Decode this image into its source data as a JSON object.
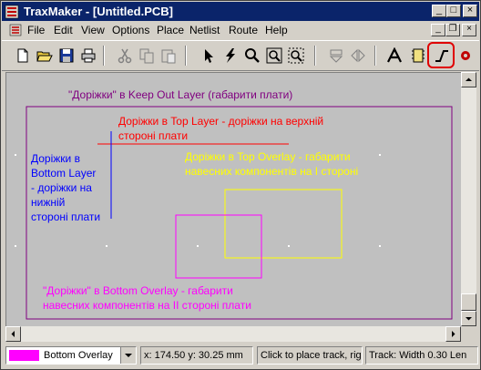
{
  "titlebar": {
    "title": "TraxMaker - [Untitled.PCB]",
    "min": "_",
    "max": "□",
    "close": "×"
  },
  "menu": {
    "items": [
      "File",
      "Edit",
      "View",
      "Options",
      "Place",
      "Netlist",
      "Route",
      "Help"
    ]
  },
  "canvas": {
    "labels": {
      "keepout": "\"Доріжки\" в Keep Out Layer (габарити плати)",
      "top_layer": "Доріжки в Top Layer - доріжки на верхній\nстороні плати",
      "bottom_layer": "Доріжки в\nBottom Layer\n- доріжки на\nнижній\nстороні плати",
      "top_overlay": "Доріжки в Top Overlay - габарити\nнавесних компонентів на І стороні",
      "bottom_overlay": "\"Доріжки\" в Bottom Overlay - габарити\nнавесних компонентів на ІІ стороні плати"
    },
    "colors": {
      "keepout": "#800080",
      "top_layer": "#ff0000",
      "bottom_layer": "#0000ff",
      "top_overlay": "#ffff00",
      "bottom_overlay": "#ff00ff"
    }
  },
  "status": {
    "layer": "Bottom Overlay",
    "layer_color": "#ff00ff",
    "coords": "x: 174.50 y: 30.25  mm",
    "hint": "Click to place track, righ",
    "track_prefix": "Track:",
    "width_label": "Width",
    "width_value": "0.30",
    "len_label": "Len"
  },
  "icons": [
    "new-file-icon",
    "open-folder-icon",
    "save-icon",
    "print-icon",
    "cut-icon",
    "copy-icon",
    "paste-icon",
    "pointer-icon",
    "lightning-icon",
    "zoom-icon",
    "zoom-fit-icon",
    "zoom-select-icon",
    "flip-vertical-icon",
    "flip-horizontal-icon",
    "text-icon",
    "component-icon",
    "track-icon",
    "via-icon"
  ]
}
